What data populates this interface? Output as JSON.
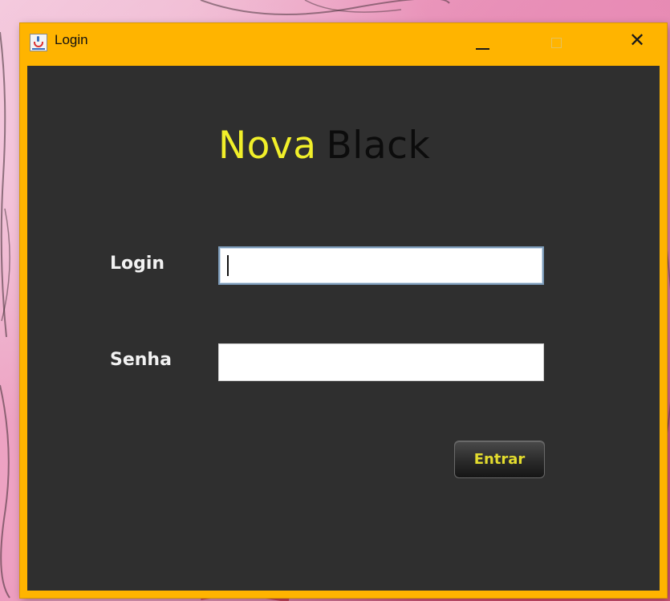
{
  "window": {
    "title": "Login",
    "icon": "java-cup-icon",
    "controls": {
      "minimize": "minimize-icon",
      "maximize": "maximize-icon",
      "close": "close-icon"
    }
  },
  "brand": {
    "first": "Nova",
    "second": "Black"
  },
  "form": {
    "login_label": "Login",
    "login_value": "",
    "senha_label": "Senha",
    "senha_value": "",
    "submit_label": "Entrar"
  },
  "colors": {
    "title_bar": "#ffb400",
    "panel": "#2f2f2f",
    "brand_accent": "#f1ef2a",
    "button_text": "#e3dc2e"
  }
}
